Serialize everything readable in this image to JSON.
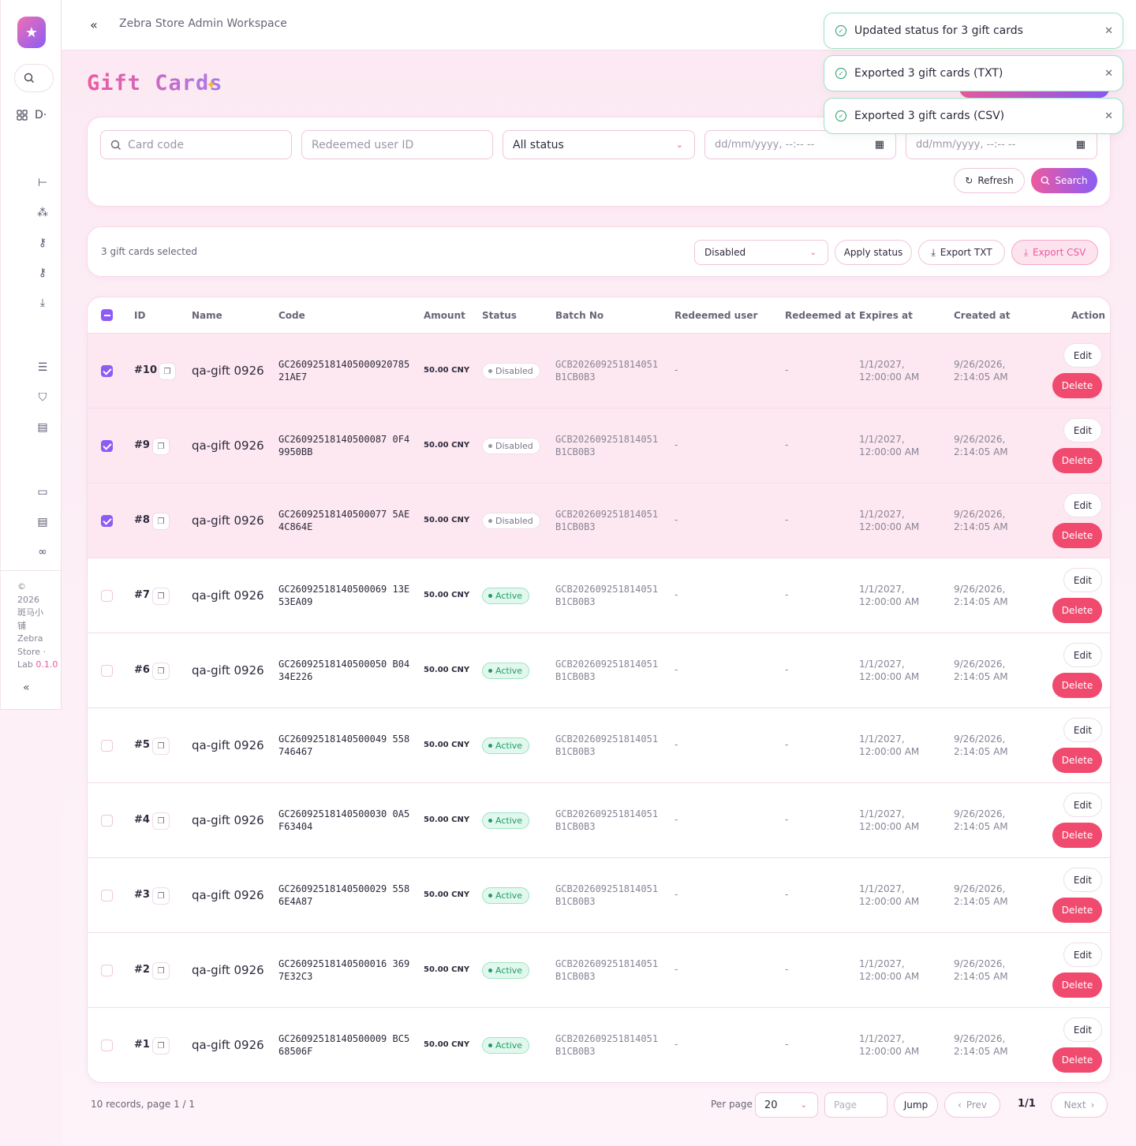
{
  "app": {
    "workspace": "Zebra Store Admin Workspace"
  },
  "sidebar": {
    "dashboard_label": "D·",
    "footer_lines": [
      "©",
      "2026",
      "斑马小",
      "铺",
      "Zebra",
      "Store ·",
      "Lab"
    ],
    "version": "0.1.0"
  },
  "page": {
    "title": "Gift Cards",
    "sparkle": "✦"
  },
  "filters": {
    "card_code_placeholder": "Card code",
    "redeemed_user_placeholder": "Redeemed user ID",
    "status_value": "All status",
    "date_from_placeholder": "dd/mm/yyyy, --:-- --",
    "date_to_placeholder": "dd/mm/yyyy, --:-- --",
    "refresh_label": "Refresh",
    "search_label": "Search"
  },
  "bulk": {
    "selected_text": "3 gift cards selected",
    "status_value": "Disabled",
    "apply_label": "Apply status",
    "export_txt_label": "Export TXT",
    "export_csv_label": "Export CSV"
  },
  "table": {
    "headers": [
      "ID",
      "Name",
      "Code",
      "Amount",
      "Status",
      "Batch No",
      "Redeemed user",
      "Redeemed at",
      "Expires at",
      "Created at",
      "Action"
    ],
    "rows": [
      {
        "id": "#10",
        "name": "qa-gift 0926",
        "code": "GC260925181405000920785 21AE7",
        "amount": "50.00 CNY",
        "status": "Disabled",
        "batch": "GCB202609251814051 B1CB0B3",
        "redeemed_user": "-",
        "redeemed_at": "-",
        "expires": "1/1/2027, 12:00:00 AM",
        "created": "9/26/2026, 2:14:05 AM",
        "selected": true
      },
      {
        "id": "#9",
        "name": "qa-gift 0926",
        "code": "GC26092518140500087 0F49950BB",
        "amount": "50.00 CNY",
        "status": "Disabled",
        "batch": "GCB202609251814051 B1CB0B3",
        "redeemed_user": "-",
        "redeemed_at": "-",
        "expires": "1/1/2027, 12:00:00 AM",
        "created": "9/26/2026, 2:14:05 AM",
        "selected": true
      },
      {
        "id": "#8",
        "name": "qa-gift 0926",
        "code": "GC26092518140500077 5AE4C864E",
        "amount": "50.00 CNY",
        "status": "Disabled",
        "batch": "GCB202609251814051 B1CB0B3",
        "redeemed_user": "-",
        "redeemed_at": "-",
        "expires": "1/1/2027, 12:00:00 AM",
        "created": "9/26/2026, 2:14:05 AM",
        "selected": true
      },
      {
        "id": "#7",
        "name": "qa-gift 0926",
        "code": "GC26092518140500069 13E53EA09",
        "amount": "50.00 CNY",
        "status": "Active",
        "batch": "GCB202609251814051 B1CB0B3",
        "redeemed_user": "-",
        "redeemed_at": "-",
        "expires": "1/1/2027, 12:00:00 AM",
        "created": "9/26/2026, 2:14:05 AM",
        "selected": false
      },
      {
        "id": "#6",
        "name": "qa-gift 0926",
        "code": "GC26092518140500050 B0434E226",
        "amount": "50.00 CNY",
        "status": "Active",
        "batch": "GCB202609251814051 B1CB0B3",
        "redeemed_user": "-",
        "redeemed_at": "-",
        "expires": "1/1/2027, 12:00:00 AM",
        "created": "9/26/2026, 2:14:05 AM",
        "selected": false
      },
      {
        "id": "#5",
        "name": "qa-gift 0926",
        "code": "GC26092518140500049 558746467",
        "amount": "50.00 CNY",
        "status": "Active",
        "batch": "GCB202609251814051 B1CB0B3",
        "redeemed_user": "-",
        "redeemed_at": "-",
        "expires": "1/1/2027, 12:00:00 AM",
        "created": "9/26/2026, 2:14:05 AM",
        "selected": false
      },
      {
        "id": "#4",
        "name": "qa-gift 0926",
        "code": "GC26092518140500030 0A5F63404",
        "amount": "50.00 CNY",
        "status": "Active",
        "batch": "GCB202609251814051 B1CB0B3",
        "redeemed_user": "-",
        "redeemed_at": "-",
        "expires": "1/1/2027, 12:00:00 AM",
        "created": "9/26/2026, 2:14:05 AM",
        "selected": false
      },
      {
        "id": "#3",
        "name": "qa-gift 0926",
        "code": "GC26092518140500029 5586E4A87",
        "amount": "50.00 CNY",
        "status": "Active",
        "batch": "GCB202609251814051 B1CB0B3",
        "redeemed_user": "-",
        "redeemed_at": "-",
        "expires": "1/1/2027, 12:00:00 AM",
        "created": "9/26/2026, 2:14:05 AM",
        "selected": false
      },
      {
        "id": "#2",
        "name": "qa-gift 0926",
        "code": "GC26092518140500016 3697E32C3",
        "amount": "50.00 CNY",
        "status": "Active",
        "batch": "GCB202609251814051 B1CB0B3",
        "redeemed_user": "-",
        "redeemed_at": "-",
        "expires": "1/1/2027, 12:00:00 AM",
        "created": "9/26/2026, 2:14:05 AM",
        "selected": false
      },
      {
        "id": "#1",
        "name": "qa-gift 0926",
        "code": "GC26092518140500009 BC568506F",
        "amount": "50.00 CNY",
        "status": "Active",
        "batch": "GCB202609251814051 B1CB0B3",
        "redeemed_user": "-",
        "redeemed_at": "-",
        "expires": "1/1/2027, 12:00:00 AM",
        "created": "9/26/2026, 2:14:05 AM",
        "selected": false
      }
    ],
    "edit_label": "Edit",
    "delete_label": "Delete"
  },
  "pagination": {
    "info": "10 records, page 1 / 1",
    "per_page_label": "Per page",
    "per_page_value": "20",
    "page_placeholder": "Page",
    "jump_label": "Jump",
    "prev_label": "Prev",
    "current": "1/1",
    "next_label": "Next"
  },
  "toasts": [
    "Updated status for 3 gift cards",
    "Exported 3 gift cards (TXT)",
    "Exported 3 gift cards (CSV)"
  ]
}
